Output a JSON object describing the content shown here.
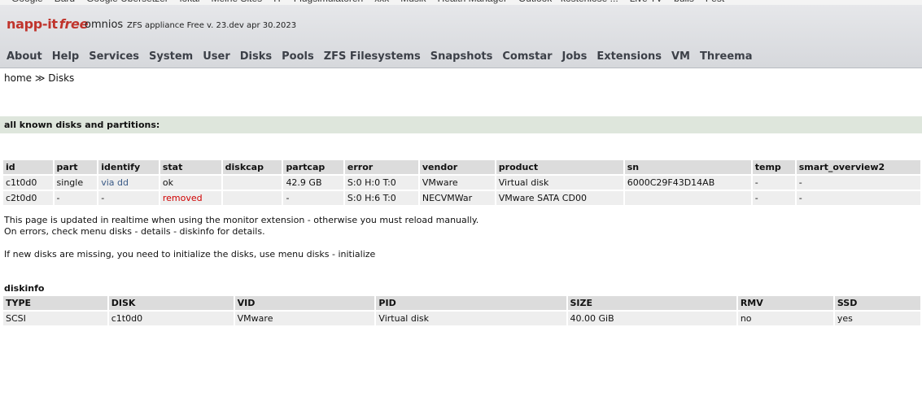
{
  "bookmarks": [
    "Google",
    "Bard",
    "Google Übersetzer",
    "lokal",
    "Meine Sites",
    "IT",
    "Flugsimulatoren",
    "xxx",
    "Musik",
    "Health Manager",
    "Outlook - kostenlose ...",
    "Live TV",
    "bulls",
    "Fest"
  ],
  "header": {
    "brand": "napp-it",
    "brand_edition": "free",
    "os_name": "omnios",
    "version": "ZFS appliance Free v. 23.dev apr 30.2023"
  },
  "nav": [
    "About",
    "Help",
    "Services",
    "System",
    "User",
    "Disks",
    "Pools",
    "ZFS Filesystems",
    "Snapshots",
    "Comstar",
    "Jobs",
    "Extensions",
    "VM",
    "Threema"
  ],
  "breadcrumb": {
    "home": "home",
    "separator": "≫",
    "current": "Disks"
  },
  "section_title": "all known disks and partitions:",
  "disks": {
    "columns": [
      "id",
      "part",
      "identify",
      "stat",
      "diskcap",
      "partcap",
      "error",
      "vendor",
      "product",
      "sn",
      "temp",
      "smart_overview2"
    ],
    "rows": [
      [
        "c1t0d0",
        "single",
        "via dd",
        "ok",
        "",
        "42.9 GB",
        "S:0 H:0 T:0",
        "VMware",
        "Virtual disk",
        "6000C29F43D14AB",
        "-",
        "-"
      ],
      [
        "c2t0d0",
        "-",
        "-",
        "removed",
        "",
        "-",
        "S:0 H:6 T:0",
        "NECVMWar",
        "VMware SATA CD00",
        "",
        "-",
        "-"
      ]
    ]
  },
  "notes": {
    "line1": "This page is updated in realtime when using the monitor extension - otherwise you must reload manually.",
    "line2": "On errors, check menu disks - details - diskinfo for details.",
    "line3": "If new disks are missing, you need to initialize the disks, use menu disks - initialize"
  },
  "diskinfo": {
    "title": "diskinfo",
    "columns": [
      "TYPE",
      "DISK",
      "VID",
      "PID",
      "SIZE",
      "RMV",
      "SSD"
    ],
    "rows": [
      [
        "SCSI",
        "c1t0d0",
        "VMware",
        "Virtual disk",
        "40.00 GiB",
        "no",
        "yes"
      ]
    ]
  },
  "colors": {
    "brand": "#c0342c",
    "link": "#3a5a86",
    "removed": "#d00000",
    "section_bar": "#dee6dc"
  }
}
